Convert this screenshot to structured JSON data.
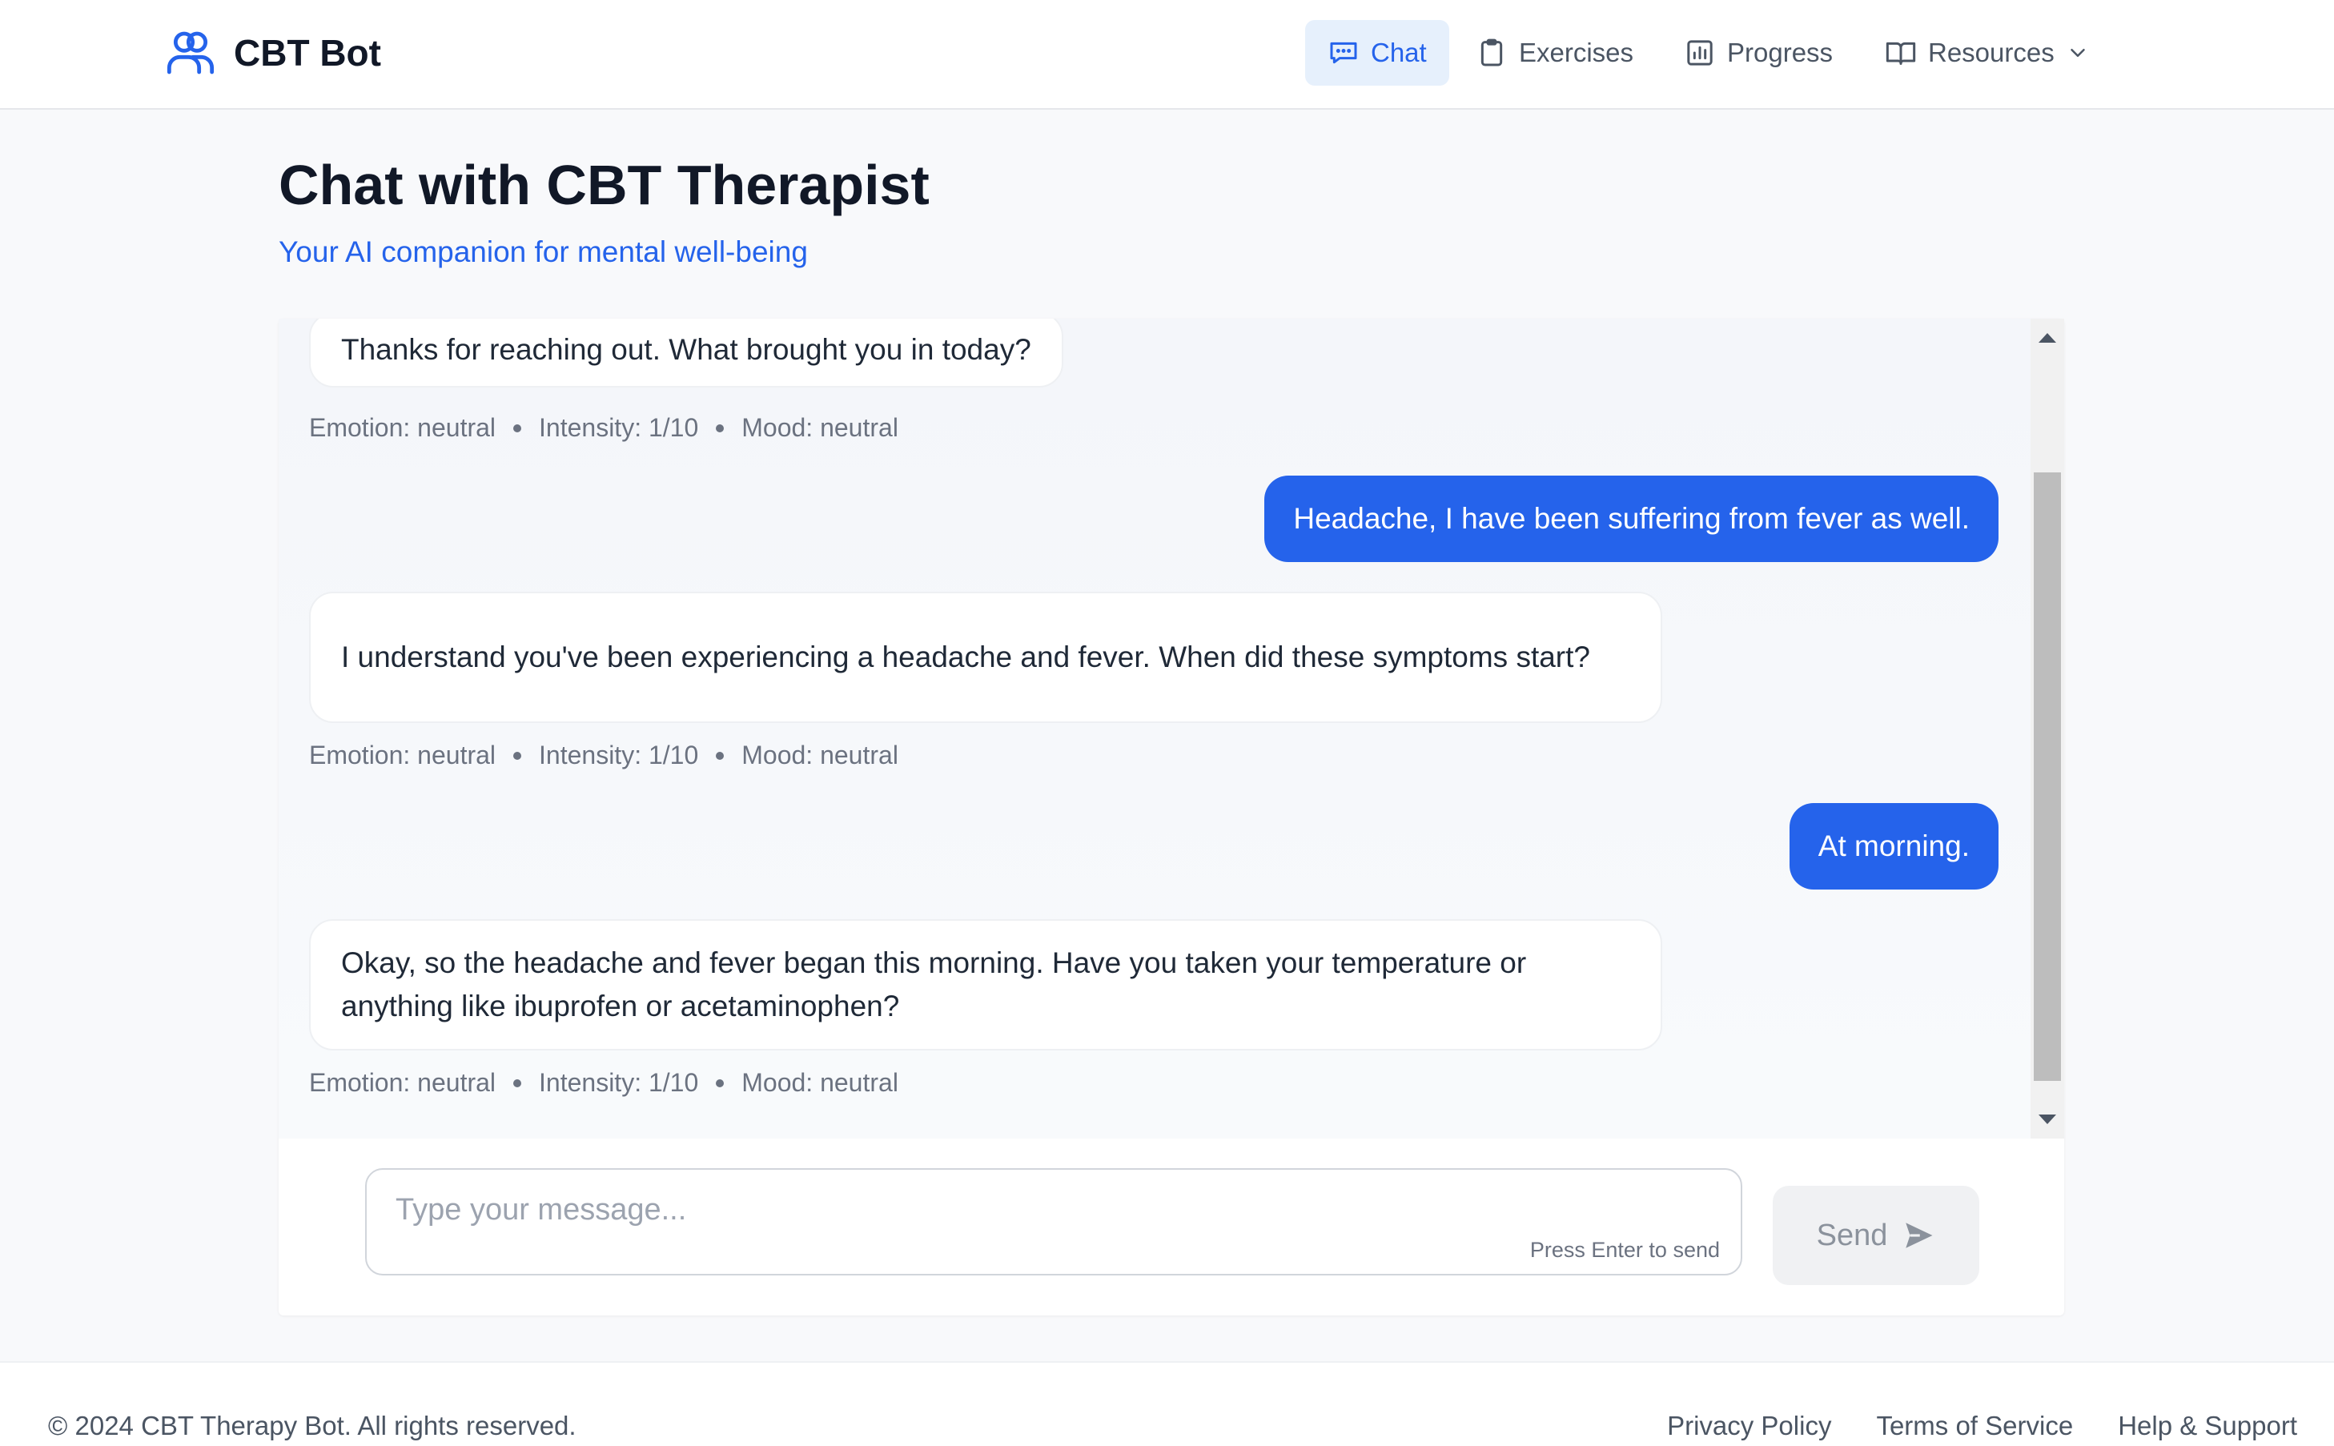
{
  "app": {
    "name": "CBT Bot",
    "logo_icon": "users-icon"
  },
  "nav": {
    "items": [
      {
        "label": "Chat",
        "icon": "chat-icon",
        "active": true
      },
      {
        "label": "Exercises",
        "icon": "clipboard-icon",
        "active": false
      },
      {
        "label": "Progress",
        "icon": "bar-chart-icon",
        "active": false
      },
      {
        "label": "Resources",
        "icon": "book-icon",
        "active": false,
        "has_dropdown": true
      }
    ]
  },
  "page": {
    "title": "Chat with CBT Therapist",
    "subtitle": "Your AI companion for mental well-being"
  },
  "messages": [
    {
      "role": "bot",
      "text": "Thanks for reaching out. What brought you in today?",
      "meta": {
        "emotion": "Emotion: neutral",
        "intensity": "Intensity: 1/10",
        "mood": "Mood: neutral"
      }
    },
    {
      "role": "user",
      "text": "Headache, I have been suffering from fever as well."
    },
    {
      "role": "bot",
      "text": "I understand you've been experiencing a headache and fever.  When did these symptoms start?",
      "meta": {
        "emotion": "Emotion: neutral",
        "intensity": "Intensity: 1/10",
        "mood": "Mood: neutral"
      }
    },
    {
      "role": "user",
      "text": "At morning."
    },
    {
      "role": "bot",
      "text": "Okay, so the headache and fever began this morning. Have you taken your temperature or anything like ibuprofen or acetaminophen?",
      "meta": {
        "emotion": "Emotion: neutral",
        "intensity": "Intensity: 1/10",
        "mood": "Mood: neutral"
      }
    }
  ],
  "composer": {
    "placeholder": "Type your message...",
    "value": "",
    "hint": "Press Enter to send",
    "send_label": "Send",
    "send_icon": "send-icon"
  },
  "footer": {
    "copyright": "© 2024 CBT Therapy Bot. All rights reserved.",
    "links": [
      "Privacy Policy",
      "Terms of Service",
      "Help & Support"
    ]
  },
  "colors": {
    "accent": "#2563eb",
    "nav_active_bg": "#e6f0fc"
  }
}
